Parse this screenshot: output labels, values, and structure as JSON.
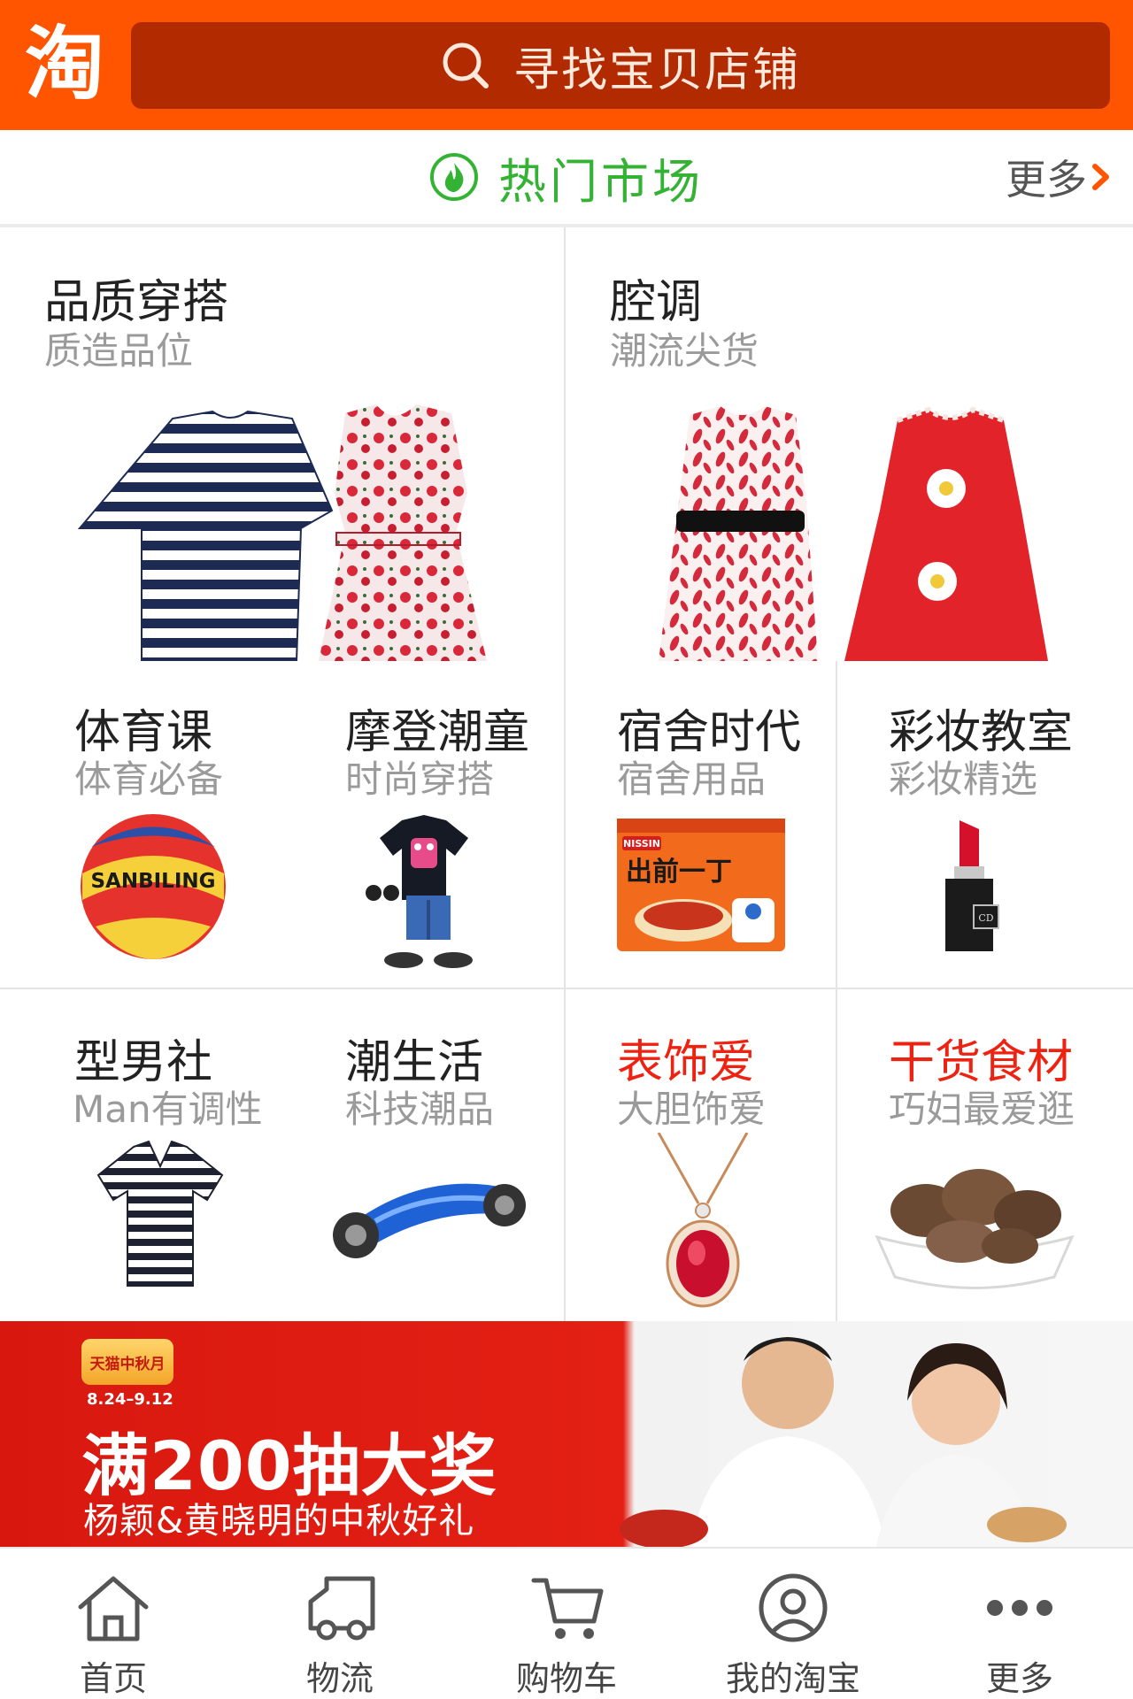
{
  "header": {
    "logo_text": "淘",
    "search_placeholder": "寻找宝贝店铺"
  },
  "hot_market": {
    "title": "热门市场",
    "more": "更多"
  },
  "featured": [
    {
      "title": "品质穿搭",
      "subtitle": "质造品位"
    },
    {
      "title": "腔调",
      "subtitle": "潮流尖货"
    }
  ],
  "categories_row1": [
    {
      "title": "体育课",
      "subtitle": "体育必备"
    },
    {
      "title": "摩登潮童",
      "subtitle": "时尚穿搭"
    },
    {
      "title": "宿舍时代",
      "subtitle": "宿舍用品"
    },
    {
      "title": "彩妆教室",
      "subtitle": "彩妆精选"
    }
  ],
  "categories_row2": [
    {
      "title": "型男社",
      "subtitle": "Man有调性"
    },
    {
      "title": "潮生活",
      "subtitle": "科技潮品"
    },
    {
      "title": "表饰爱",
      "subtitle": "大胆饰爱"
    },
    {
      "title": "干货食材",
      "subtitle": "巧妇最爱逛"
    }
  ],
  "product_labels": {
    "ball": "SANBILING",
    "noodle_brand": "NISSIN",
    "noodle_name": "出前一丁",
    "lipstick_cap": "CD"
  },
  "banner": {
    "tag": "天猫中秋月",
    "date": "8.24–9.12",
    "headline": "满200抽大奖",
    "subline": "杨颖&黄晓明的中秋好礼"
  },
  "tabs": [
    {
      "label": "首页",
      "icon": "home-icon"
    },
    {
      "label": "物流",
      "icon": "truck-icon"
    },
    {
      "label": "购物车",
      "icon": "cart-icon"
    },
    {
      "label": "我的淘宝",
      "icon": "user-icon"
    },
    {
      "label": "更多",
      "icon": "more-dots-icon"
    }
  ],
  "colors": {
    "brand_orange": "#ff5500",
    "search_bg": "#b12a00",
    "hot_green": "#34b233",
    "highlight_red": "#ee2211"
  }
}
